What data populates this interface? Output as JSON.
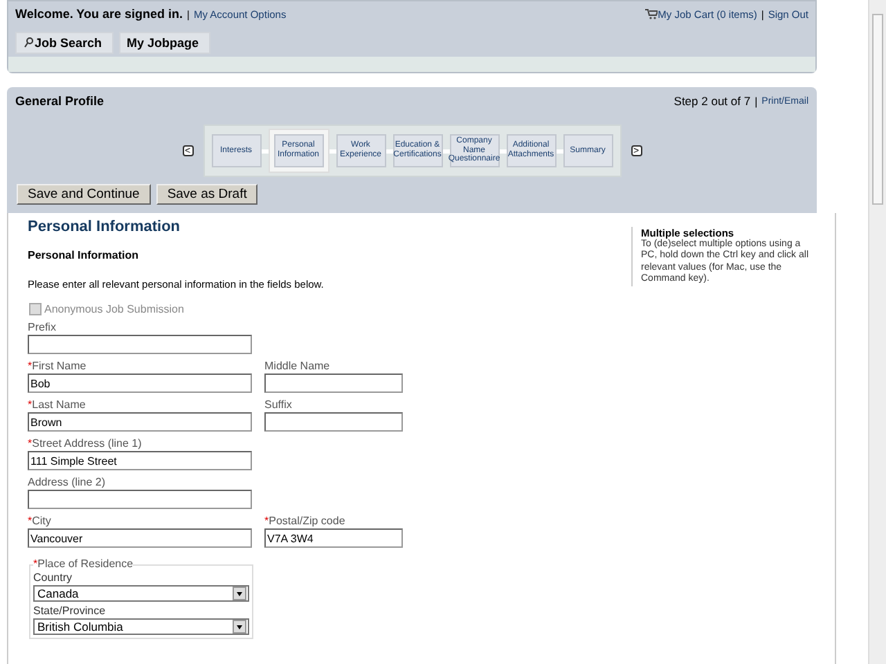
{
  "header": {
    "welcome": "Welcome. You are signed in.",
    "account_link": "My Account Options",
    "cart_link": "My Job Cart (0 items)",
    "sign_out": "Sign Out",
    "separators": [
      "|",
      "|"
    ]
  },
  "nav_tabs": [
    {
      "label": "Job Search",
      "kind": "search"
    },
    {
      "label": "My Jobpage",
      "kind": "plain"
    }
  ],
  "profile": {
    "title": "General Profile",
    "step": "Step 2 out of 7",
    "print_link": "Print/Email",
    "separator": "|",
    "prev": "<",
    "next": ">",
    "steps": [
      {
        "label": "Interests",
        "selected": false
      },
      {
        "label": "Personal Information",
        "selected": true
      },
      {
        "label": "Work Experience",
        "selected": false
      },
      {
        "label": "Education & Certifications",
        "selected": false
      },
      {
        "label": "Company Name Questionnaire",
        "selected": false
      },
      {
        "label": "Additional Attachments",
        "selected": false
      },
      {
        "label": "Summary",
        "selected": false
      }
    ],
    "buttons": [
      "Save and Continue",
      "Save as Draft"
    ]
  },
  "form": {
    "heading": "Personal Information",
    "subheading": "Personal Information",
    "intro": "Please enter all relevant personal information in the fields below.",
    "anonymous": {
      "label": "Anonymous Job Submission",
      "checked": false,
      "disabled": true
    },
    "rows": [
      [
        {
          "label": "Prefix",
          "required": false
        }
      ],
      [
        {
          "label": "First Name",
          "required": true,
          "value": "Bob"
        },
        {
          "label": "Middle Name",
          "required": false
        }
      ],
      [
        {
          "label": "Last Name",
          "required": true,
          "value": "Brown"
        },
        {
          "label": "Suffix",
          "required": false
        }
      ],
      [
        {
          "label": "Street Address (line 1)",
          "required": true,
          "value": "111 Simple Street"
        }
      ],
      [
        {
          "label": "Address (line 2)",
          "required": false
        }
      ],
      [
        {
          "label": "City",
          "required": true,
          "value": "Vancouver"
        },
        {
          "label": "Postal/Zip code",
          "required": true,
          "value": "V7A 3W4"
        }
      ]
    ],
    "residence": {
      "legend": "Place of Residence",
      "required": true,
      "selects": [
        {
          "label": "Country",
          "value": "Canada"
        },
        {
          "label": "State/Province",
          "value": "British Columbia"
        }
      ]
    },
    "required_mark": "*"
  },
  "help": {
    "title": "Multiple selections",
    "text": "To (de)select multiple options using a PC, hold down the Ctrl key and click all relevant values (for Mac, use the Command key)."
  }
}
